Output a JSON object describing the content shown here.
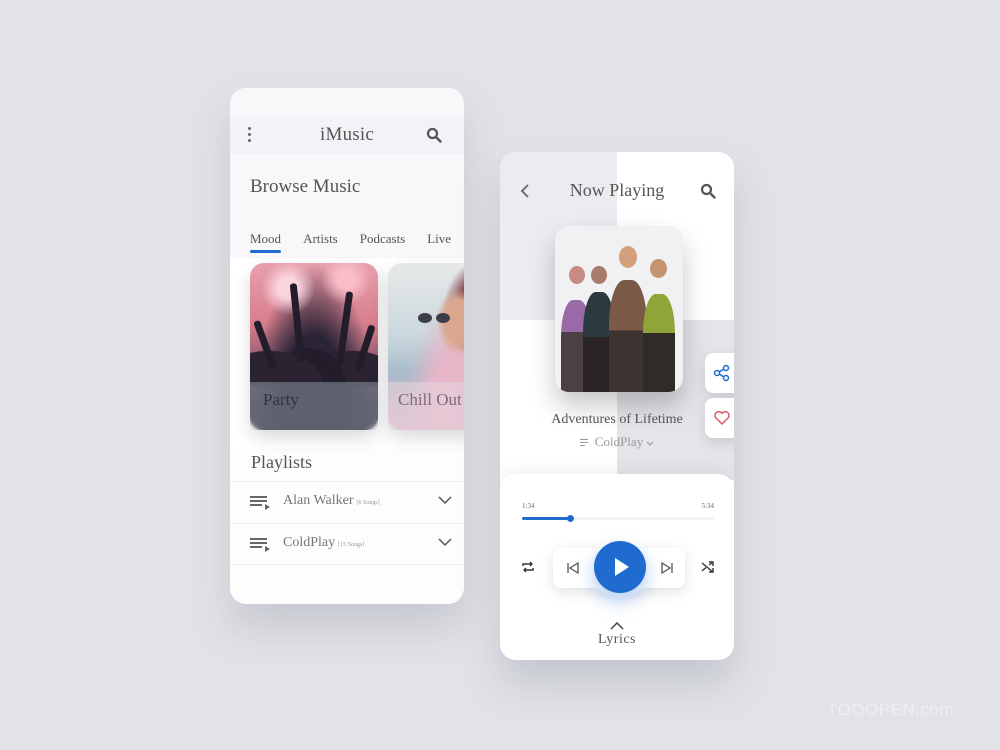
{
  "browse_screen": {
    "app_title": "iMusic",
    "menu_icon": "kebab-menu-icon",
    "search_icon": "search-icon",
    "section_title": "Browse Music",
    "tabs": [
      {
        "label": "Mood",
        "active": true
      },
      {
        "label": "Artists",
        "active": false
      },
      {
        "label": "Podcasts",
        "active": false
      },
      {
        "label": "Live",
        "active": false
      }
    ],
    "mood_tiles": [
      {
        "label": "Party"
      },
      {
        "label": "Chill Out"
      }
    ],
    "playlists_title": "Playlists",
    "playlists": [
      {
        "name": "Alan Walker",
        "count": "[6 Songs]",
        "icon": "playlist-icon"
      },
      {
        "name": "ColdPlay",
        "count": "[15 Songs]",
        "icon": "playlist-icon"
      }
    ]
  },
  "now_playing_screen": {
    "title": "Now Playing",
    "back_icon": "chevron-left-icon",
    "search_icon": "search-icon",
    "song_title": "Adventures of Lifetime",
    "artist": "ColdPlay",
    "side_actions": [
      "share-icon",
      "heart-icon"
    ],
    "player": {
      "current_time": "1:34",
      "total_time": "5:34",
      "progress": 0.25,
      "controls": [
        "repeat-icon",
        "previous-icon",
        "play-icon",
        "next-icon",
        "shuffle-icon"
      ],
      "lyrics_label": "Lyrics"
    }
  },
  "colors": {
    "accent": "#1f6bd0",
    "heart": "#e0566e",
    "background": "#e2e3e8"
  },
  "watermark": "TOOOPEN.com"
}
